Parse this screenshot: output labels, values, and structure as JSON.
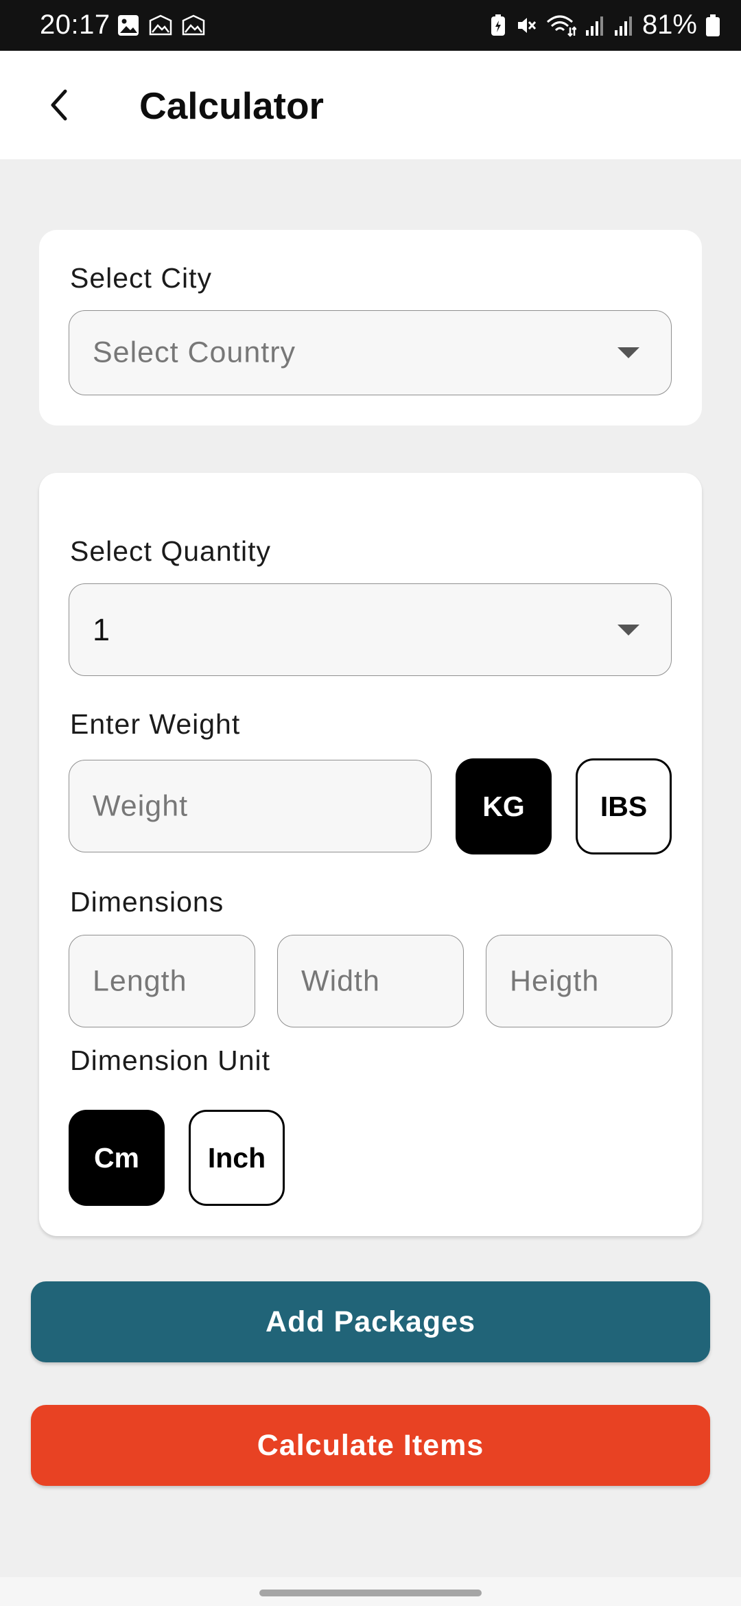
{
  "status_bar": {
    "time": "20:17",
    "notification_icons": [
      "image-icon",
      "gallery-icon",
      "gallery-icon"
    ],
    "status_icons": [
      "battery-saver-icon",
      "mute-icon",
      "wifi-icon",
      "signal-icon",
      "signal-icon"
    ],
    "battery": "81%"
  },
  "header": {
    "back_icon": "chevron-left-icon",
    "title": "Calculator"
  },
  "city_card": {
    "label": "Select City",
    "dropdown_placeholder": "Select Country",
    "dropdown_icon": "caret-down-icon"
  },
  "package_card": {
    "quantity_label": "Select Quantity",
    "quantity_value": "1",
    "weight_label": "Enter Weight",
    "weight_placeholder": "Weight",
    "weight_units": [
      {
        "label": "KG",
        "selected": true
      },
      {
        "label": "IBS",
        "selected": false
      }
    ],
    "dimensions_label": "Dimensions",
    "length_placeholder": "Length",
    "width_placeholder": "Width",
    "height_placeholder": "Heigth",
    "dimension_unit_label": "Dimension Unit",
    "dimension_units": [
      {
        "label": "Cm",
        "selected": true
      },
      {
        "label": "Inch",
        "selected": false
      }
    ]
  },
  "actions": {
    "add_packages": "Add Packages",
    "calculate_items": "Calculate Items"
  },
  "colors": {
    "add_button": "#216478",
    "calculate_button": "#e84223",
    "selected_unit": "#000000"
  }
}
